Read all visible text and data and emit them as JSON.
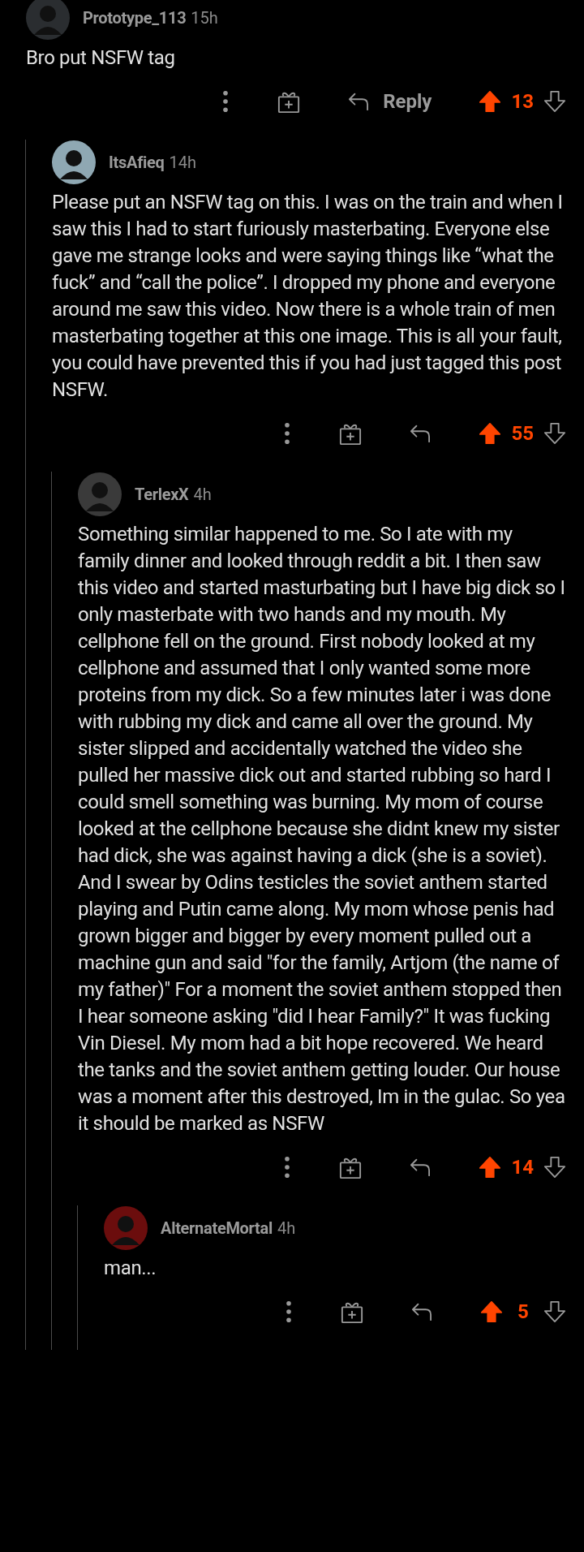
{
  "comments": [
    {
      "author": "Prototype_113",
      "time": "15h",
      "body": "Bro put NSFW tag",
      "reply_label": "Reply",
      "score": "13",
      "upvoted": true,
      "children": [
        {
          "author": "ItsAfieq",
          "time": "14h",
          "body": "Please put an NSFW tag on this. I was on the train and when I saw this I had to start furiously masterbating. Everyone else gave me strange looks and were saying things like “what the fuck” and “call the police”. I dropped my phone and everyone around me saw this video. Now there is a whole train of men masterbating together at this one image. This is all your fault, you could have prevented this if you had just tagged this post NSFW.",
          "score": "55",
          "upvoted": true,
          "children": [
            {
              "author": "TerlexX",
              "time": "4h",
              "body": "Something similar happened to me. So I ate with my family dinner and looked through reddit a bit. I then saw this video and started masturbating but I have big dick so I only masterbate with two hands and my mouth. My cellphone fell on the ground. First nobody looked at my cellphone and assumed that I only wanted some more proteins from my dick. So a few minutes later i was done with rubbing my dick and came all over the ground. My sister slipped and accidentally watched the video she pulled her massive dick out and started rubbing so hard I could smell something was burning. My mom of course looked at the cellphone because she didnt knew my sister had dick, she was against having a dick (she is a soviet). And I swear by Odins testicles the soviet anthem started playing and Putin came along. My mom whose penis had grown bigger and bigger by every moment pulled out a machine gun and said \"for the family, Artjom (the name of my father)\" For a moment the soviet anthem stopped then I hear someone asking \"did I hear Family?\" It was fucking Vin Diesel. My mom had a bit hope recovered. We heard the tanks and the soviet anthem getting louder. Our house was a moment after this destroyed, Im in the gulac. So yea it should be marked as NSFW",
              "score": "14",
              "upvoted": true,
              "children": [
                {
                  "author": "AlternateMortal",
                  "time": "4h",
                  "body": "man...",
                  "score": "5",
                  "upvoted": true
                }
              ]
            }
          ]
        }
      ]
    }
  ]
}
